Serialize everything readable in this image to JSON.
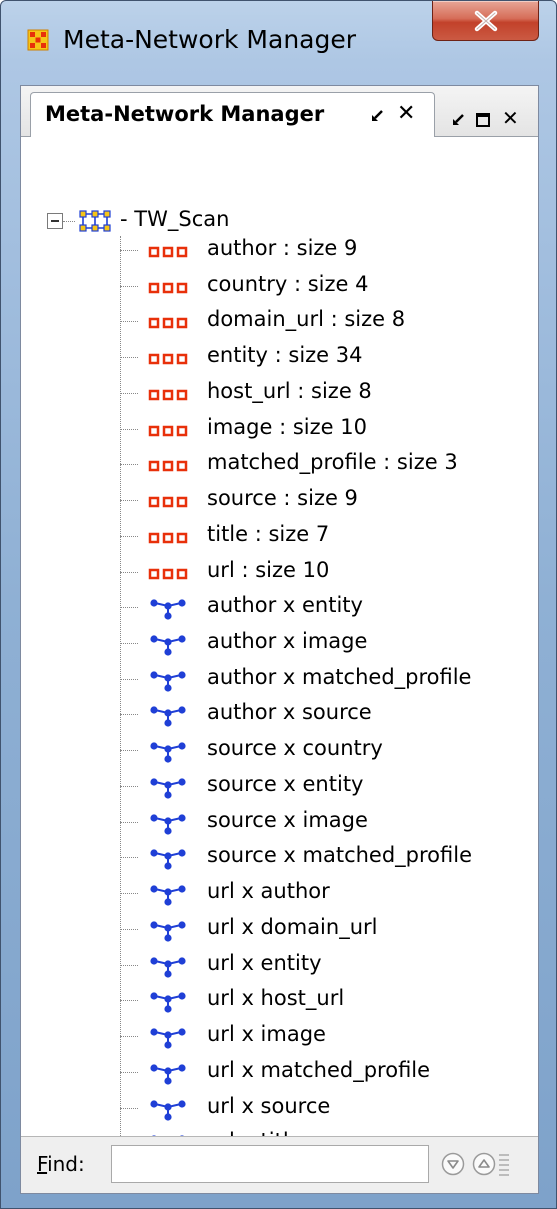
{
  "window": {
    "title": "Meta-Network Manager"
  },
  "tab": {
    "label": "Meta-Network Manager"
  },
  "tree": {
    "root": "TW_Scan",
    "nodesets": [
      "author : size 9",
      "country : size 4",
      "domain_url : size 8",
      "entity : size 34",
      "host_url : size 8",
      "image : size 10",
      "matched_profile : size 3",
      "source : size 9",
      "title : size 7",
      "url : size 10"
    ],
    "networks": [
      "author x entity",
      "author x image",
      "author x matched_profile",
      "author x source",
      "source x country",
      "source x entity",
      "source x image",
      "source x matched_profile",
      "url x author",
      "url x domain_url",
      "url x entity",
      "url x host_url",
      "url x image",
      "url x matched_profile",
      "url x source",
      "url x title"
    ]
  },
  "find": {
    "label_first": "F",
    "label_rest": "ind:",
    "value": ""
  },
  "colors": {
    "nodeset_icon": "#e8300a",
    "network_icon": "#1f3fd6",
    "title_close": "#c2412a"
  }
}
